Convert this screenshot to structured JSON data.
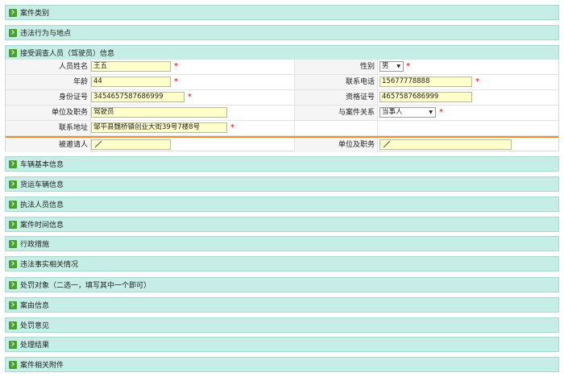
{
  "sections": {
    "case_category": "案件类别",
    "violation": "违法行为与地点",
    "respondent_info": "接受调查人员（驾驶员）信息",
    "vehicle_basic": "车辆基本信息",
    "freight_vehicle": "货运车辆信息",
    "law_enforcers": "执法人员信息",
    "case_time": "案件时间信息",
    "admin_measures": "行政措施",
    "facts": "违法事实相关情况",
    "penalty_target": "处罚对象（二选一，填写其中一个即可）",
    "cause": "案由信息",
    "penalty_opinion": "处罚意见",
    "result": "处理结果",
    "attachments": "案件相关附件"
  },
  "form": {
    "name_label": "人员姓名",
    "name_value": "王五",
    "gender_label": "性别",
    "gender_value": "男",
    "age_label": "年龄",
    "age_value": "44",
    "phone_label": "联系电话",
    "phone_value": "15677778888",
    "id_label": "身份证号",
    "id_value": "3454657587686999",
    "cert_label": "资格证号",
    "cert_value": "4657587686999",
    "unit_label": "单位及职务",
    "unit_value": "驾驶员",
    "relation_label": "与案件关系",
    "relation_value": "当事人",
    "address_label": "联系地址",
    "address_value": "邹平县魏桥镇创业大街39号7楼8号",
    "invitee_label": "被邀请人",
    "invitee_unit_label": "单位及职务",
    "required_mark": "*"
  }
}
